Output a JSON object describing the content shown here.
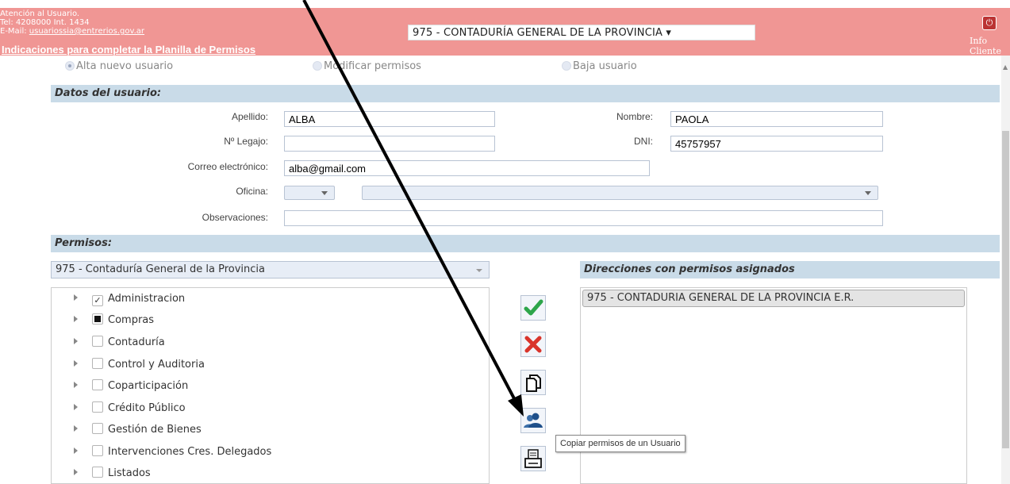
{
  "header": {
    "contact_line1": "Atención al Usuario.",
    "contact_line2": "Tel: 4208000 Int. 1434",
    "contact_mail_label": "E-Mail:",
    "contact_mail": "usuariossia@entrerios.gov.ar",
    "instructions_link": "Indicaciones para completar la Planilla de Permisos",
    "org_selector": "975 - CONTADURÍA GENERAL DE LA PROVINCIA ▾",
    "power_icon": "⏻",
    "info_cliente": "Info Cliente",
    "bg_color": "#f09694"
  },
  "radios": [
    {
      "label": "Alta nuevo usuario",
      "selected": true
    },
    {
      "label": "Modificar permisos",
      "selected": false
    },
    {
      "label": "Baja usuario",
      "selected": false
    }
  ],
  "user_section": {
    "title": "Datos del usuario:",
    "apellido_label": "Apellido:",
    "apellido_value": "ALBA",
    "nombre_label": "Nombre:",
    "nombre_value": "PAOLA",
    "legajo_label": "Nº Legajo:",
    "legajo_value": "",
    "dni_label": "DNI:",
    "dni_value": "45757957",
    "email_label": "Correo electrónico:",
    "email_value": "alba@gmail.com",
    "oficina_label": "Oficina:",
    "observaciones_label": "Observaciones:",
    "observaciones_value": ""
  },
  "permisos": {
    "title": "Permisos:",
    "selector": "975 - Contaduría General de la Provincia",
    "items": [
      {
        "label": "Administracion",
        "state": "checked"
      },
      {
        "label": "Compras",
        "state": "partial"
      },
      {
        "label": "Contaduría",
        "state": "unchecked"
      },
      {
        "label": "Control y Auditoria",
        "state": "unchecked"
      },
      {
        "label": "Coparticipación",
        "state": "unchecked"
      },
      {
        "label": "Crédito Público",
        "state": "unchecked"
      },
      {
        "label": "Gestión de Bienes",
        "state": "unchecked"
      },
      {
        "label": "Intervenciones Cres. Delegados",
        "state": "unchecked"
      },
      {
        "label": "Listados",
        "state": "unchecked"
      }
    ]
  },
  "actions": {
    "tooltip": "Copiar permisos de un Usuario",
    "buttons": [
      "confirm-checkmark-icon",
      "delete-x-icon",
      "copy-document-icon",
      "copy-user-permissions-icon",
      "print-icon"
    ]
  },
  "directions": {
    "title": "Direcciones con permisos asignados",
    "items": [
      "975 - CONTADURIA GENERAL DE LA PROVINCIA E.R."
    ]
  }
}
